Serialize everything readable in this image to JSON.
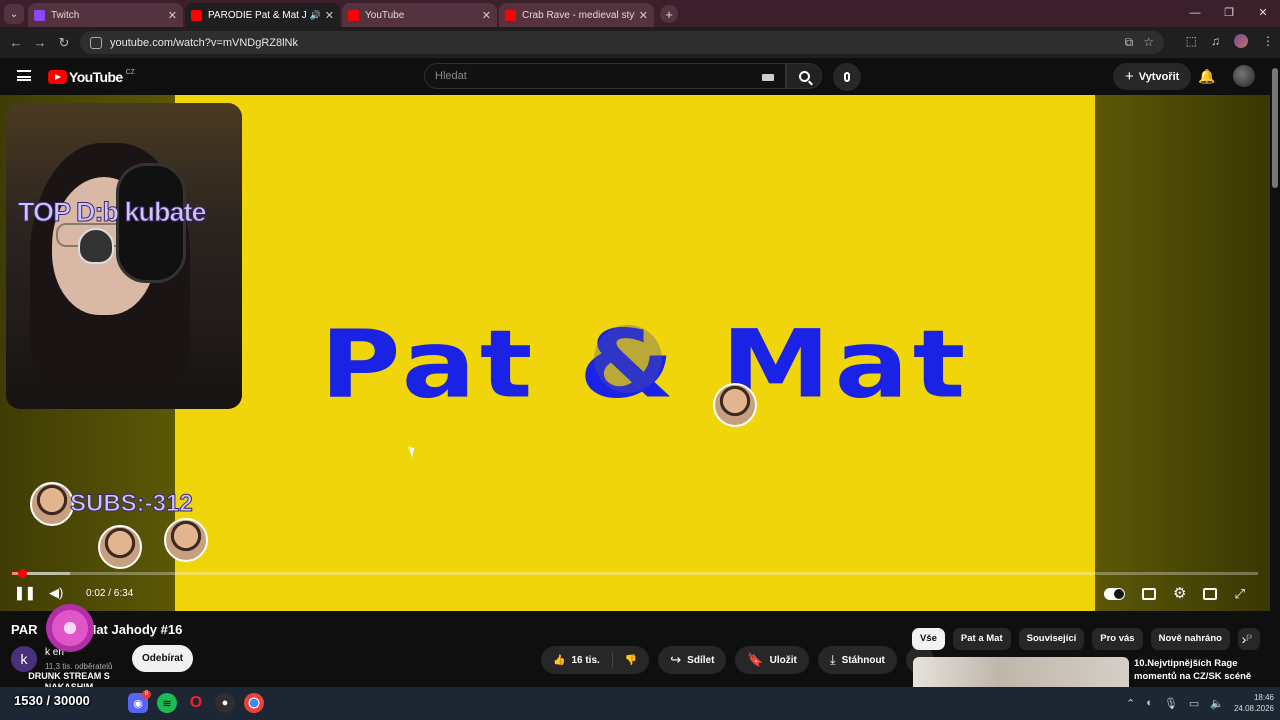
{
  "browser": {
    "tabs": [
      {
        "title": "Twitch",
        "color": "#9146ff",
        "active": false
      },
      {
        "title": "PARODIE Pat & Mat Jahody",
        "color": "#ff0000",
        "active": true
      },
      {
        "title": "YouTube",
        "color": "#ff0000",
        "active": false
      },
      {
        "title": "Crab Rave - medieval style - Yo",
        "color": "#ff0000",
        "active": false
      }
    ],
    "url": "youtube.com/watch?v=mVNDgRZ8lNk"
  },
  "youtube": {
    "country_code": "CZ",
    "logo_text": "YouTube",
    "search_placeholder": "Hledat",
    "create_label": "Vytvořit"
  },
  "video": {
    "frame_title": "Pat & Mat",
    "current_time": "0:02",
    "duration": "6:34",
    "time_display": "0:02 / 6:34",
    "progress_fraction": 0.005,
    "title": "PARODIE Pat & Mat Jahody #16",
    "title_visible": "PAR",
    "title_visible_end": "Mat Jahody #16"
  },
  "overlay": {
    "cam_title": "TOP D:b  kubate",
    "subs_text": "SUBS:-312",
    "drunk_text": "DRUNK STREAM S NAKASHIM",
    "counter": "1530 / 30000"
  },
  "channel": {
    "avatar_letter": "k",
    "name": "k         en",
    "subscribers": "11,3 tis. odběratelů",
    "subscribe_label": "Odebírat"
  },
  "actions": {
    "likes": "16 tis.",
    "share": "Sdílet",
    "save": "Uložit",
    "download": "Stáhnout"
  },
  "chips": [
    "Vše",
    "Pat a Mat",
    "Související",
    "Pro vás",
    "Nově nahráno",
    "P"
  ],
  "recommendation": {
    "title": "10.Nejvtipnějších Rage momentů na CZ/SK scéně"
  },
  "taskbar": {
    "time": "18:46",
    "date": "24.08.2026",
    "discord_badge": "8"
  }
}
